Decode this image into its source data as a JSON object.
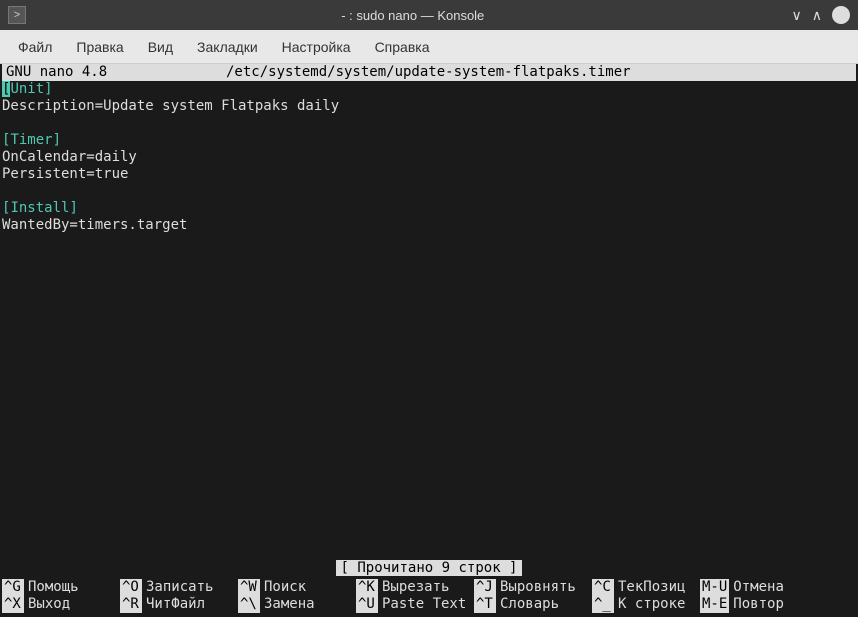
{
  "window": {
    "title": "- : sudo nano — Konsole"
  },
  "menubar": {
    "items": [
      "Файл",
      "Правка",
      "Вид",
      "Закладки",
      "Настройка",
      "Справка"
    ]
  },
  "nano": {
    "header_left": " GNU nano 4.8",
    "header_path": "/etc/systemd/system/update-system-flatpaks.timer",
    "content": {
      "section1": "Unit",
      "line1": "Description=Update system Flatpaks daily",
      "section2": "Timer",
      "line2": "OnCalendar=daily",
      "line3": "Persistent=true",
      "section3": "Install",
      "line4": "WantedBy=timers.target"
    },
    "status": "[ Прочитано 9 строк ]",
    "shortcuts": [
      {
        "key": "^G",
        "label": "Помощь"
      },
      {
        "key": "^O",
        "label": "Записать"
      },
      {
        "key": "^W",
        "label": "Поиск"
      },
      {
        "key": "^K",
        "label": "Вырезать"
      },
      {
        "key": "^J",
        "label": "Выровнять"
      },
      {
        "key": "^C",
        "label": "ТекПозиц"
      },
      {
        "key": "M-U",
        "label": "Отмена"
      },
      {
        "key": "^X",
        "label": "Выход"
      },
      {
        "key": "^R",
        "label": "ЧитФайл"
      },
      {
        "key": "^\\",
        "label": "Замена"
      },
      {
        "key": "^U",
        "label": "Paste Text"
      },
      {
        "key": "^T",
        "label": "Словарь"
      },
      {
        "key": "^_",
        "label": "К строке"
      },
      {
        "key": "M-E",
        "label": "Повтор"
      }
    ]
  }
}
